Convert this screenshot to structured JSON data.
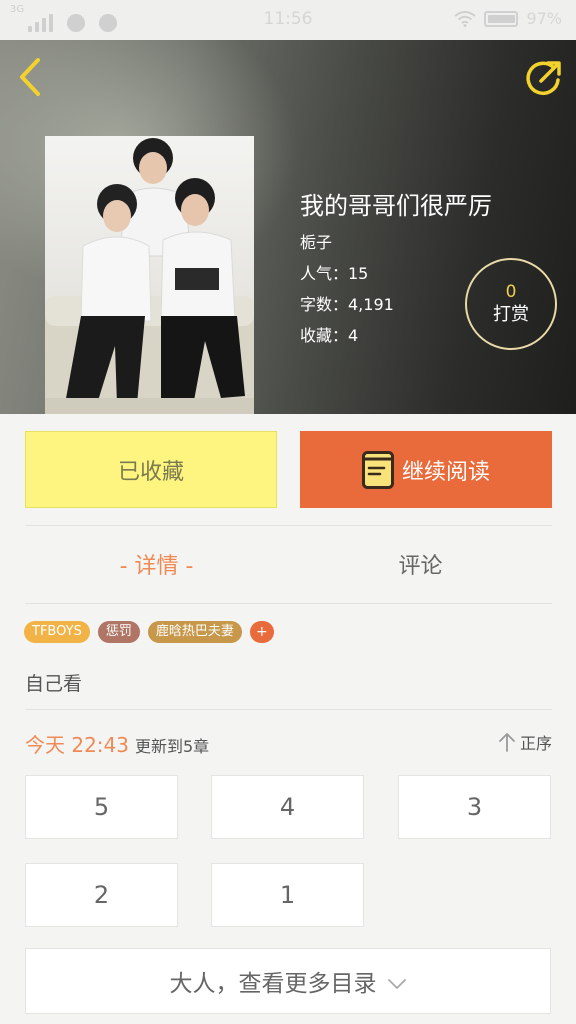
{
  "status_bar": {
    "network": "3G",
    "time": "11:56",
    "battery": "97%"
  },
  "header": {
    "back_icon": "chevron-left-icon",
    "share_icon": "share-arrow-icon",
    "title": "我的哥哥们很严厉",
    "author": "栀子",
    "popularity": "人气：15",
    "word_count": "字数：4,191",
    "favorites": "收藏：4",
    "tip": {
      "count": "0",
      "label": "打赏"
    }
  },
  "actions": {
    "favorite_label": "已收藏",
    "read_label": "继续阅读",
    "read_icon": "book-icon"
  },
  "tabs": [
    {
      "label": "- 详情 -",
      "active": true
    },
    {
      "label": "评论",
      "active": false
    }
  ],
  "tags": [
    "TFBOYS",
    "惩罚",
    "鹿晗热巴夫妻",
    "+"
  ],
  "description": "自己看",
  "update": {
    "time": "今天 22:43",
    "text": "更新到5章",
    "sort_label": "正序",
    "sort_icon": "arrow-up-icon"
  },
  "chapters": [
    "5",
    "4",
    "3",
    "2",
    "1"
  ],
  "more_label": "大人，查看更多目录",
  "colors": {
    "accent": "#e96a3a",
    "highlight": "#ef8a55",
    "favorite_bg": "#fdf57f",
    "tip_count": "#f0cf4c"
  }
}
